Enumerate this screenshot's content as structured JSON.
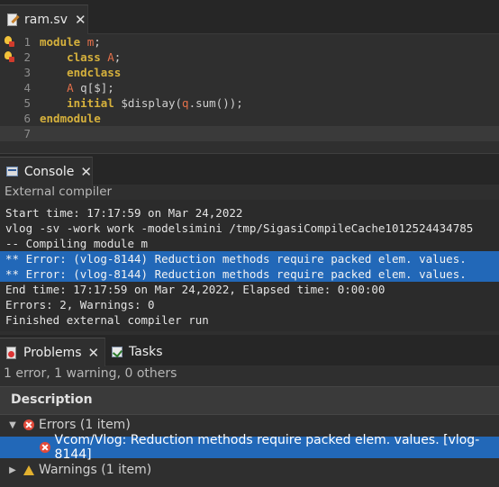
{
  "editor": {
    "tab_title": "ram.sv",
    "close_glyph": "✕",
    "lines": [
      {
        "n": "1",
        "tokens": [
          {
            "t": "module ",
            "c": "kw"
          },
          {
            "t": "m",
            "c": "id"
          },
          {
            "t": ";",
            "c": "plain"
          }
        ]
      },
      {
        "n": "2",
        "tokens": [
          {
            "t": "    class ",
            "c": "kw"
          },
          {
            "t": "A",
            "c": "id"
          },
          {
            "t": ";",
            "c": "plain"
          }
        ]
      },
      {
        "n": "3",
        "tokens": [
          {
            "t": "    endclass",
            "c": "kw"
          }
        ]
      },
      {
        "n": "4",
        "tokens": [
          {
            "t": "    ",
            "c": "plain"
          },
          {
            "t": "A",
            "c": "id"
          },
          {
            "t": " q[$];",
            "c": "plain"
          }
        ]
      },
      {
        "n": "5",
        "tokens": [
          {
            "t": "    initial ",
            "c": "kw"
          },
          {
            "t": "$display(",
            "c": "plain"
          },
          {
            "t": "q",
            "c": "id"
          },
          {
            "t": ".sum());",
            "c": "plain"
          }
        ]
      },
      {
        "n": "6",
        "tokens": [
          {
            "t": "endmodule",
            "c": "kw"
          }
        ]
      },
      {
        "n": "7",
        "tokens": []
      }
    ]
  },
  "console": {
    "tab_label": "Console",
    "close_glyph": "✕",
    "subtitle": "External compiler",
    "lines": [
      {
        "text": "Start time: 17:17:59 on Mar 24,2022",
        "selected": false
      },
      {
        "text": "vlog -sv -work work -modelsimini /tmp/SigasiCompileCache1012524434785",
        "selected": false
      },
      {
        "text": "-- Compiling module m",
        "selected": false
      },
      {
        "text": "** Error: (vlog-8144) Reduction methods require packed elem. values.",
        "selected": true
      },
      {
        "text": "** Error: (vlog-8144) Reduction methods require packed elem. values.",
        "selected": true
      },
      {
        "text": "End time: 17:17:59 on Mar 24,2022, Elapsed time: 0:00:00",
        "selected": false
      },
      {
        "text": "Errors: 2, Warnings: 0",
        "selected": false
      },
      {
        "text": "Finished external compiler run",
        "selected": false
      }
    ]
  },
  "problems": {
    "tab_label": "Problems",
    "close_glyph": "✕",
    "tasks_label": "Tasks",
    "summary": "1 error, 1 warning, 0 others",
    "column_header": "Description",
    "errors_group": "Errors (1 item)",
    "error_item": "Vcom/Vlog: Reduction methods require packed elem. values. [vlog-8144]",
    "warnings_group": "Warnings (1 item)"
  },
  "colors": {
    "keyword": "#d6b13c",
    "identifier": "#e5704a",
    "selection": "#2268b8",
    "background": "#2f2f2f"
  }
}
